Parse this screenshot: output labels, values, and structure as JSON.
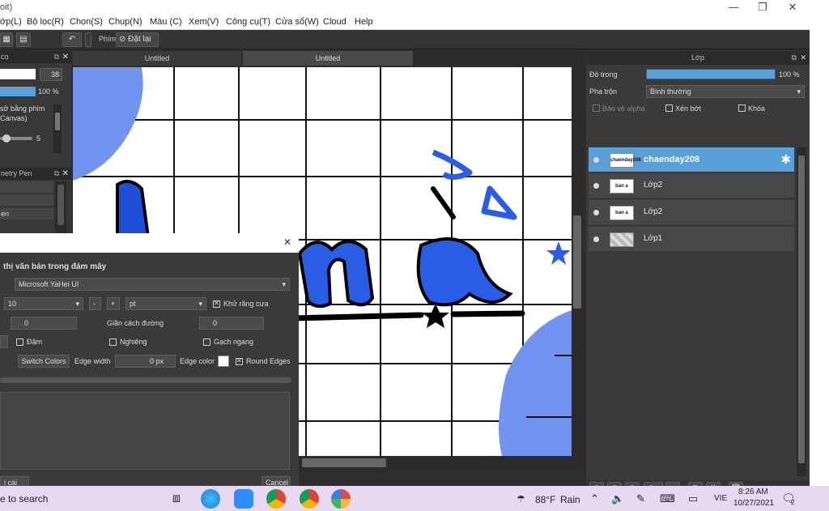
{
  "window": {
    "title": "oit)",
    "controls": [
      "—",
      "❐",
      "✕"
    ]
  },
  "menu": [
    "ớp(L)",
    "Bộ lọc(R)",
    "Chọn(S)",
    "Chụp(N)",
    "Màu (C)",
    "Xem(V)",
    "Công cụ(T)",
    "Cửa sổ(W)",
    "Cloud",
    "Help"
  ],
  "toolbar": {
    "shortcut_label": "Phím",
    "reset_label": "Đặt lại"
  },
  "brush_panel": {
    "title": "cọ",
    "size_value": "38",
    "opacity_value": "100 %",
    "note_line1": "sở bằng phím",
    "note_line2": "Canvas)",
    "correction_value": "5"
  },
  "symmetry_panel": {
    "title": "netry Pen",
    "item": "en"
  },
  "tabs": [
    "Untitled",
    "Untitled"
  ],
  "layers_panel": {
    "title": "Lớp",
    "opacity_label": "Độ trong",
    "opacity_value": "100 %",
    "opacity_fraction": 1.0,
    "blend_label": "Pha trộn",
    "blend_value": "Bình thường",
    "protect_alpha": "Bảo vệ alpha",
    "clipping": "Xén bớt",
    "lock": "Khóa",
    "layers": [
      {
        "name": "chaenday208",
        "thumb": "chaenday208",
        "selected": true
      },
      {
        "name": "Lớp2",
        "thumb": "ban a",
        "selected": false
      },
      {
        "name": "Lớp2",
        "thumb": "ban a",
        "selected": false
      },
      {
        "name": "Lớp1",
        "thumb": "",
        "selected": false
      }
    ]
  },
  "dialog": {
    "heading": "thị văn bản trong đám mây",
    "font": "Microsoft YaHei UI",
    "size": "10",
    "minus": "-",
    "plus": "+",
    "unit": "pt",
    "antialias": "Khử răng cưa",
    "char_spacing": "0",
    "line_spacing_label": "Giãn cách đường",
    "line_spacing": "0",
    "bold": "Đậm",
    "italic": "Nghiêng",
    "horizontal": "Gạch ngang",
    "switch_colors": "Switch Colors",
    "edge_width_label": "Edge width",
    "edge_width": "0 px",
    "edge_color_label": "Edge color",
    "round_edges": "Round Edges",
    "settings_button": "i cài đặt",
    "cancel_button": "Cancel",
    "close": "✕"
  },
  "taskbar": {
    "search": "e to search",
    "weather_temp": "88°F",
    "weather_text": "Rain",
    "language": "VIE",
    "time": "8:26 AM",
    "date": "10/27/2021",
    "notifications": "2"
  },
  "colors": {
    "accent": "#5aa0d8",
    "canvas_blue": "#1d4fd8",
    "canvas_light_blue": "#7094f0",
    "panel_dark": "#3a3a3a"
  }
}
